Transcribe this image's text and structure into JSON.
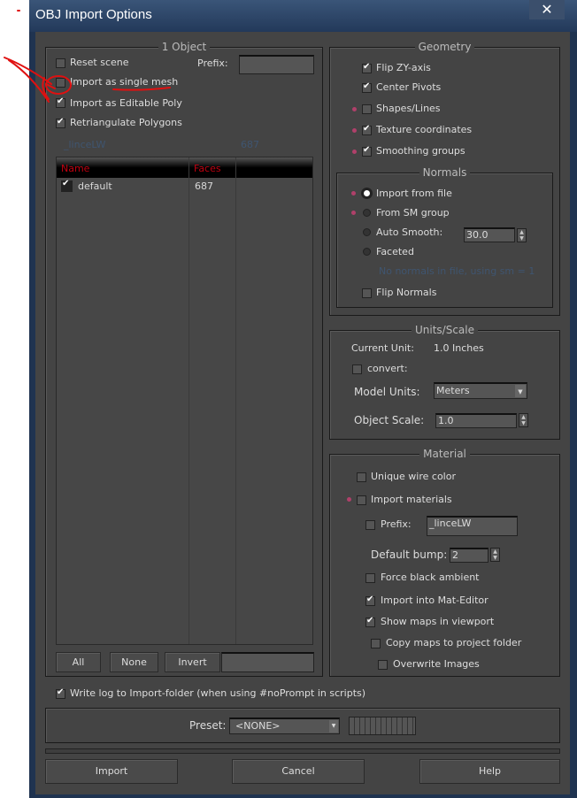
{
  "window": {
    "title": "OBJ Import Options",
    "close_icon": "close-icon"
  },
  "object_group": {
    "title": "1 Object",
    "reset_scene": {
      "label": "Reset scene",
      "checked": false
    },
    "prefix_label": "Prefix:",
    "prefix_value": "",
    "single_mesh": {
      "label": "Import as single mesh",
      "checked": false
    },
    "editable_poly": {
      "label": "Import as Editable Poly",
      "checked": true
    },
    "retriangulate": {
      "label": "Retriangulate Polygons",
      "checked": true
    },
    "info_name": "_linceLW",
    "info_faces": "687",
    "table": {
      "columns": [
        "Name",
        "Faces"
      ],
      "rows": [
        {
          "name": "default",
          "faces": "687",
          "checked": true
        }
      ]
    },
    "buttons": {
      "all": "All",
      "none": "None",
      "invert": "Invert"
    },
    "filter_value": ""
  },
  "geometry": {
    "title": "Geometry",
    "flip_zy": {
      "label": "Flip ZY-axis",
      "checked": true
    },
    "center_pivots": {
      "label": "Center Pivots",
      "checked": true
    },
    "shapes_lines": {
      "label": "Shapes/Lines",
      "checked": false
    },
    "texture_coords": {
      "label": "Texture coordinates",
      "checked": true
    },
    "smoothing_groups": {
      "label": "Smoothing groups",
      "checked": true
    }
  },
  "normals": {
    "title": "Normals",
    "import_from_file": "Import from file",
    "from_sm_group": "From SM group",
    "auto_smooth": "Auto Smooth:",
    "auto_smooth_value": "30.0",
    "faceted": "Faceted",
    "selected": "Import from file",
    "info": "No normals in file, using sm = 1",
    "flip_normals": {
      "label": "Flip Normals",
      "checked": false
    }
  },
  "units": {
    "title": "Units/Scale",
    "current_unit_label": "Current Unit:",
    "current_unit_value": "1.0 Inches",
    "convert": {
      "label": "convert:",
      "checked": false
    },
    "model_units_label": "Model Units:",
    "model_units_value": "Meters",
    "object_scale_label": "Object Scale:",
    "object_scale_value": "1.0"
  },
  "material": {
    "title": "Material",
    "unique_wire": {
      "label": "Unique wire color",
      "checked": false
    },
    "import_materials": {
      "label": "Import materials",
      "checked": false
    },
    "prefix": {
      "label": "Prefix:",
      "checked": false,
      "value": "_linceLW"
    },
    "default_bump_label": "Default bump:",
    "default_bump_value": "2",
    "force_black": {
      "label": "Force black ambient",
      "checked": false
    },
    "mat_editor": {
      "label": "Import into Mat-Editor",
      "checked": true
    },
    "show_maps": {
      "label": "Show maps in viewport",
      "checked": true
    },
    "copy_maps": {
      "label": "Copy maps to project folder",
      "checked": false
    },
    "overwrite": {
      "label": "Overwrite Images",
      "checked": false
    }
  },
  "write_log": {
    "label": "Write log to Import-folder (when using #noPrompt in scripts)",
    "checked": true
  },
  "preset": {
    "label": "Preset:",
    "value": "<NONE>"
  },
  "progress": 0,
  "footer": {
    "import": "Import",
    "cancel": "Cancel",
    "help": "Help"
  },
  "annotation_color": "#e01010"
}
